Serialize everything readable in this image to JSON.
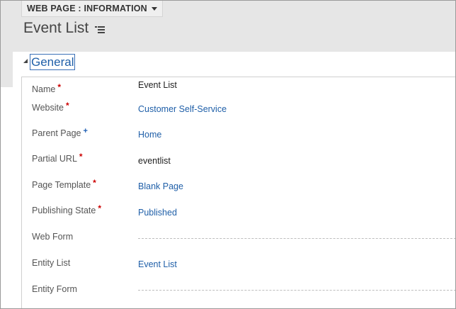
{
  "header": {
    "form_selector": "WEB PAGE : INFORMATION",
    "record_title": "Event List"
  },
  "section": {
    "title": "General"
  },
  "fields": [
    {
      "label": "Name",
      "marker": "*",
      "value": "Event List"
    },
    {
      "label": "Website",
      "marker": "*",
      "value": "Customer Self-Service"
    },
    {
      "label": "Parent Page",
      "marker": "+",
      "value": "Home"
    },
    {
      "label": "Partial URL",
      "marker": "*",
      "value": "eventlist"
    },
    {
      "label": "Page Template",
      "marker": "*",
      "value": "Blank Page"
    },
    {
      "label": "Publishing State",
      "marker": "*",
      "value": "Published"
    },
    {
      "label": "Web Form",
      "marker": "",
      "value": ""
    },
    {
      "label": "Entity List",
      "marker": "",
      "value": "Event List"
    },
    {
      "label": "Entity Form",
      "marker": "",
      "value": ""
    }
  ],
  "colors": {
    "link": "#1f5fa8",
    "required": "#cc0000",
    "recommended": "#1e5fb4",
    "header_bg": "#e6e6e6"
  },
  "icons": {
    "form_selector_caret": "caret-down-icon",
    "title_menu": "list-menu-icon",
    "section_toggle": "collapse-triangle-icon"
  }
}
